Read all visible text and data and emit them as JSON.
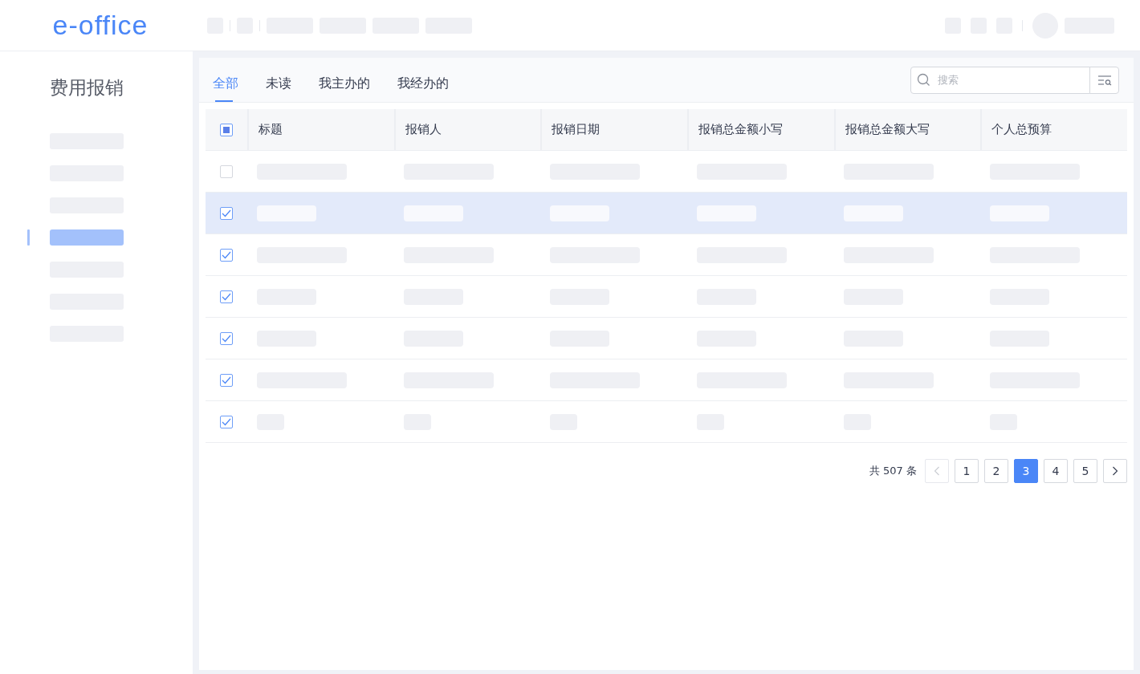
{
  "header": {
    "logo": "e-office"
  },
  "sidebar": {
    "title": "费用报销",
    "items": [
      {
        "selected": false
      },
      {
        "selected": false
      },
      {
        "selected": false
      },
      {
        "selected": true
      },
      {
        "selected": false
      },
      {
        "selected": false
      },
      {
        "selected": false
      }
    ]
  },
  "tabs": [
    {
      "label": "全部",
      "selected": true
    },
    {
      "label": "未读",
      "selected": false
    },
    {
      "label": "我主办的",
      "selected": false
    },
    {
      "label": "我经办的",
      "selected": false
    }
  ],
  "search": {
    "placeholder": "搜索"
  },
  "table": {
    "select_all": {
      "indeterminate": true
    },
    "columns": [
      "标题",
      "报销人",
      "报销日期",
      "报销总金额小写",
      "报销总金额大写",
      "个人总预算"
    ],
    "rows": [
      {
        "checked": false,
        "selected": false,
        "kind": "long"
      },
      {
        "checked": true,
        "selected": true,
        "kind": "short"
      },
      {
        "checked": true,
        "selected": false,
        "kind": "long"
      },
      {
        "checked": true,
        "selected": false,
        "kind": "short"
      },
      {
        "checked": true,
        "selected": false,
        "kind": "short"
      },
      {
        "checked": true,
        "selected": false,
        "kind": "long"
      },
      {
        "checked": true,
        "selected": false,
        "kind": "tiny"
      }
    ]
  },
  "pagination": {
    "total": "共 507 条",
    "prev_disabled": true,
    "pages": [
      {
        "label": "1",
        "selected": false
      },
      {
        "label": "2",
        "selected": false
      },
      {
        "label": "3",
        "selected": true
      },
      {
        "label": "4",
        "selected": false
      },
      {
        "label": "5",
        "selected": false
      }
    ]
  }
}
